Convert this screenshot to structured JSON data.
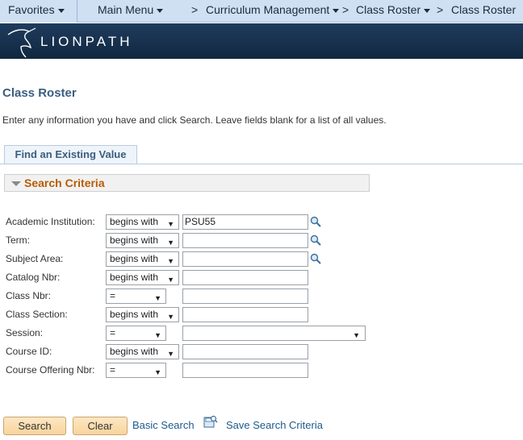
{
  "nav": {
    "favorites": "Favorites",
    "main_menu": "Main Menu",
    "separator": ">",
    "curriculum": "Curriculum Management",
    "class_roster_menu": "Class Roster",
    "class_roster_crumb": "Class Roster"
  },
  "brand": {
    "logo_text": "LIONPATH"
  },
  "page": {
    "title": "Class Roster",
    "instructions": "Enter any information you have and click Search. Leave fields blank for a list of all values."
  },
  "tab": {
    "label": "Find an Existing Value"
  },
  "criteria": {
    "label": "Search Criteria"
  },
  "fields": [
    {
      "label": "Academic Institution:",
      "operator": "begins with",
      "value": "PSU55",
      "lookup": true
    },
    {
      "label": "Term:",
      "operator": "begins with",
      "value": "",
      "lookup": true
    },
    {
      "label": "Subject Area:",
      "operator": "begins with",
      "value": "",
      "lookup": true
    },
    {
      "label": "Catalog Nbr:",
      "operator": "begins with",
      "value": ""
    },
    {
      "label": "Class Nbr:",
      "operator": "=",
      "value": ""
    },
    {
      "label": "Class Section:",
      "operator": "begins with",
      "value": ""
    },
    {
      "label": "Session:",
      "operator": "=",
      "value": ""
    },
    {
      "label": "Course ID:",
      "operator": "begins with",
      "value": ""
    },
    {
      "label": "Course Offering Nbr:",
      "operator": "=",
      "value": ""
    }
  ],
  "dropdown_arrow": "▼",
  "buttons": {
    "search": "Search",
    "clear": "Clear",
    "basic_search": "Basic Search",
    "save_criteria": "Save Search Criteria"
  },
  "icons": {
    "lookup": "magnifier-icon",
    "save": "save-search-icon",
    "logo": "lion-icon"
  },
  "colors": {
    "nav_bg": "#cfe0f2",
    "banner_bg": "#1f3c5e",
    "title": "#3a5e80",
    "criteria_label": "#b85c00",
    "button_bg": "#f8d49d",
    "link": "#1c5a8c"
  }
}
